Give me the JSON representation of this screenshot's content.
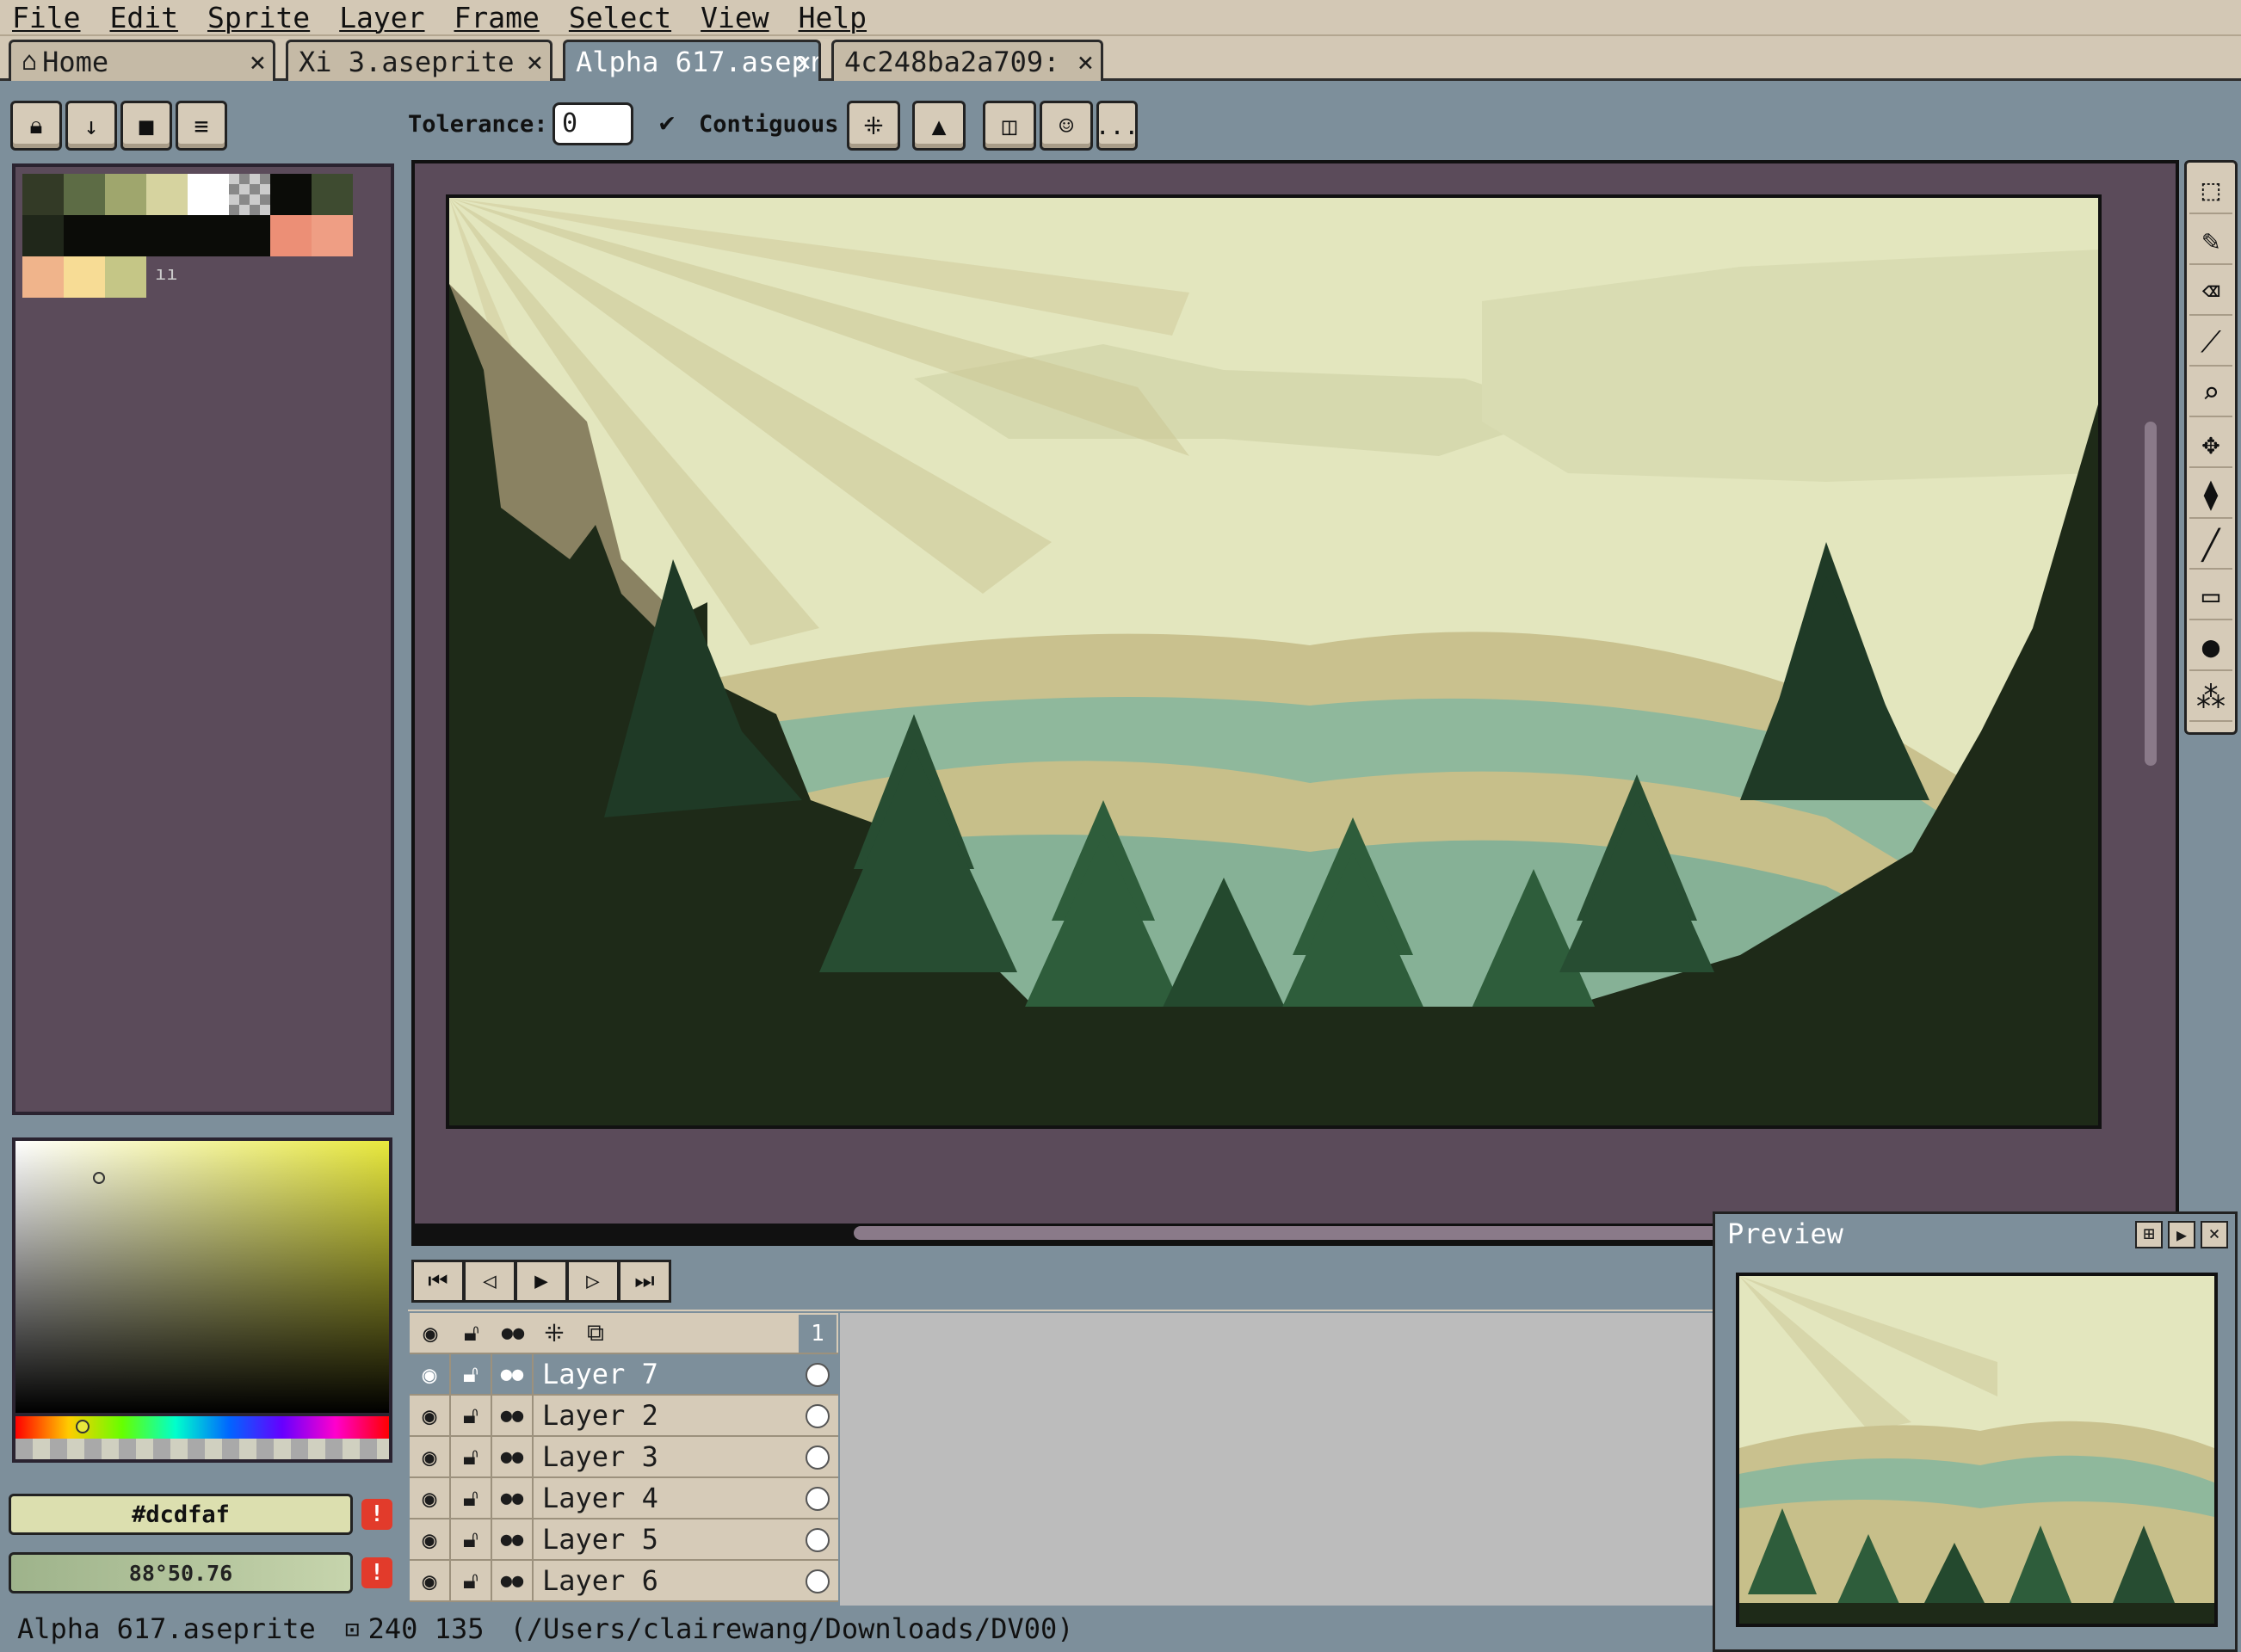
{
  "menu": [
    "File",
    "Edit",
    "Sprite",
    "Layer",
    "Frame",
    "Select",
    "View",
    "Help"
  ],
  "tabs": [
    {
      "label": "Home",
      "icon": "home-icon",
      "active": false
    },
    {
      "label": "Xi 3.aseprite",
      "active": false
    },
    {
      "label": "Alpha 617.asepr",
      "active": true
    },
    {
      "label": "4c248ba2a709:",
      "active": false
    }
  ],
  "tab_close_glyph": "×",
  "context": {
    "tolerance_label": "Tolerance:",
    "tolerance_value": "0",
    "contiguous_label": "Contiguous",
    "more_label": "..."
  },
  "palette": {
    "row1": [
      "#333a26",
      "#5d6c45",
      "#9fa66d",
      "#d6d39f",
      "#ffffff",
      "checker",
      "#0b0c08",
      "#3e4b30"
    ],
    "row2": [
      "#20271a",
      "#0b0c08",
      "#0b0c08",
      "#0b0c08",
      "#0b0c08",
      "#0b0c08",
      "#ec8f76",
      "#ef9e84"
    ],
    "row3": [
      "#f0b48b",
      "#f7dc95",
      "#c5c686"
    ],
    "grip": "ıı"
  },
  "colors": {
    "foreground_hex": "#dcdfaf",
    "background_label": "88°50.76"
  },
  "tools": [
    "rect-select-icon",
    "pencil-icon",
    "eraser-icon",
    "eyedropper-icon",
    "zoom-icon",
    "move-icon",
    "fill-icon",
    "line-icon",
    "rectangle-icon",
    "blur-icon",
    "spray-icon"
  ],
  "timeline": {
    "frame_number": "1",
    "layers": [
      {
        "name": "Layer 7",
        "selected": true
      },
      {
        "name": "Layer 2",
        "selected": false
      },
      {
        "name": "Layer 3",
        "selected": false
      },
      {
        "name": "Layer 4",
        "selected": false
      },
      {
        "name": "Layer 5",
        "selected": false
      },
      {
        "name": "Layer 6",
        "selected": false
      }
    ]
  },
  "preview": {
    "title": "Preview"
  },
  "status": {
    "filename": "Alpha 617.aseprite",
    "size": "240 135",
    "path": "(/Users/clairewang/Downloads/DV00)"
  },
  "accent": {
    "selection": "#7d8f9b",
    "workspace": "#5b4b5a",
    "chrome": "#d6cbb8"
  }
}
